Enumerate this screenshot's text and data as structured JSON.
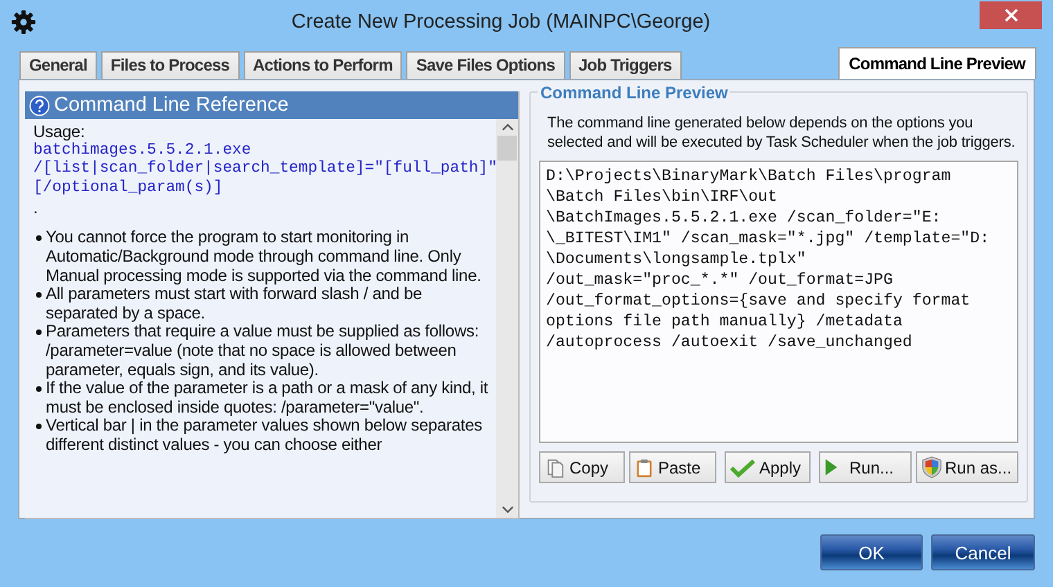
{
  "window": {
    "title": "Create New Processing Job (MAINPC\\George)"
  },
  "tabs": [
    {
      "label": "General",
      "selected": false
    },
    {
      "label": "Files to Process",
      "selected": false
    },
    {
      "label": "Actions to Perform",
      "selected": false
    },
    {
      "label": "Save Files Options",
      "selected": false
    },
    {
      "label": "Job Triggers",
      "selected": false
    },
    {
      "label": "Command Line Preview",
      "selected": true
    }
  ],
  "reference": {
    "title": "Command Line Reference",
    "usage_label": "Usage:",
    "usage_code": [
      "batchimages.5.5.2.1.exe",
      "/[list|scan_folder|search_template]=\"[full_path]\"",
      "[/optional_param(s)]"
    ],
    "dot": ".",
    "bullets": [
      "You cannot force the program to start monitoring in Automatic/Background mode through command line. Only Manual processing mode is supported via the command line.",
      "All parameters must start with forward slash / and be separated by a space.",
      "Parameters that require a value must be supplied as follows: /parameter=value (note that no space is allowed between parameter, equals sign, and its value).",
      "If the value of the parameter is a path or a mask of any kind, it must be enclosed inside quotes: /parameter=\"value\".",
      "Vertical bar | in the parameter values shown below separates different distinct values - you can choose either"
    ]
  },
  "preview": {
    "title": "Command Line Preview",
    "description": "The command line generated below depends on the options you selected and will be executed by Task Scheduler when the job triggers.",
    "value_lines": [
      "D:\\Projects\\BinaryMark\\Batch Files\\program",
      "\\Batch Files\\bin\\IRF\\out",
      "\\BatchImages.5.5.2.1.exe /scan_folder=\"E:",
      "\\_BITEST\\IM1\" /scan_mask=\"*.jpg\" /template=\"D:",
      "\\Documents\\longsample.tplx\"",
      "/out_mask=\"proc_*.*\" /out_format=JPG",
      "/out_format_options={save and specify format",
      "options file path manually} /metadata",
      "/autoprocess /autoexit /save_unchanged"
    ],
    "buttons": [
      {
        "label": "Copy",
        "kind": "copy"
      },
      {
        "label": "Paste",
        "kind": "paste"
      },
      {
        "label": "Apply",
        "kind": "apply"
      },
      {
        "label": "Run...",
        "kind": "run"
      },
      {
        "label": "Run as...",
        "kind": "runas"
      }
    ]
  },
  "dialog_buttons": [
    "OK",
    "Cancel"
  ]
}
